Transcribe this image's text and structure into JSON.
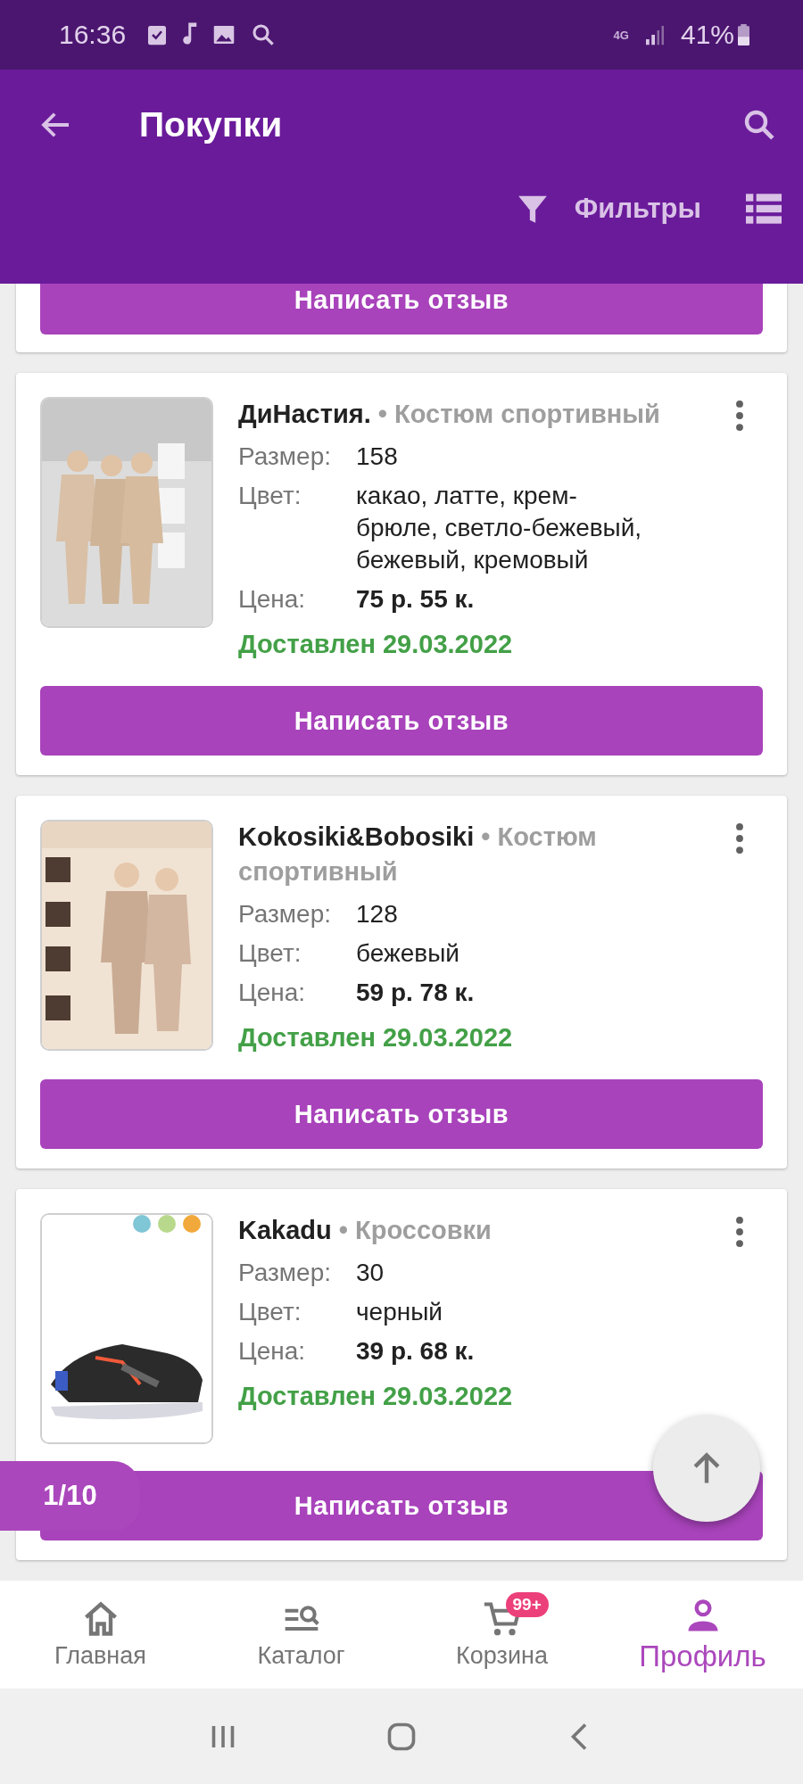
{
  "status_bar": {
    "time": "16:36",
    "network": "4G",
    "battery": "41%"
  },
  "app_bar": {
    "title": "Покупки",
    "filters_label": "Фильтры"
  },
  "orders": [
    {
      "kind": "partial",
      "button": "Написать отзыв"
    },
    {
      "kind": "full",
      "brand": "ДиНастия.",
      "category": "• Костюм спортивный",
      "size_label": "Размер:",
      "size": "158",
      "color_label": "Цвет:",
      "color_text": "какао, латте, крем-брюле, светло-бежевый, бежевый, кремовый",
      "price_label": "Цена:",
      "price": "75 р. 55 к.",
      "status": "Доставлен 29.03.2022",
      "button": "Написать отзыв"
    },
    {
      "kind": "full",
      "brand": "Kokosiki&Bobosiki",
      "category": "• Костюм спортивный",
      "size_label": "Размер:",
      "size": "128",
      "color_label": "Цвет:",
      "color_text": "бежевый",
      "price_label": "Цена:",
      "price": "59 р. 78 к.",
      "status": "Доставлен 29.03.2022",
      "button": "Написать отзыв"
    },
    {
      "kind": "full",
      "brand": "Kakadu",
      "category": "• Кроссовки",
      "size_label": "Размер:",
      "size": "30",
      "color_label": "Цвет:",
      "color_text": "черный",
      "price_label": "Цена:",
      "price": "39 р. 68 к.",
      "status": "Доставлен 29.03.2022",
      "button": "Написать отзыв"
    }
  ],
  "pager": "1/10",
  "bottom_nav": [
    {
      "kind": "home",
      "label": "Главная",
      "selected": false
    },
    {
      "kind": "catalog",
      "label": "Каталог",
      "selected": false
    },
    {
      "kind": "cart",
      "label": "Корзина",
      "selected": false,
      "badge": "99+"
    },
    {
      "kind": "profile",
      "label": "Профиль",
      "selected": true
    }
  ]
}
